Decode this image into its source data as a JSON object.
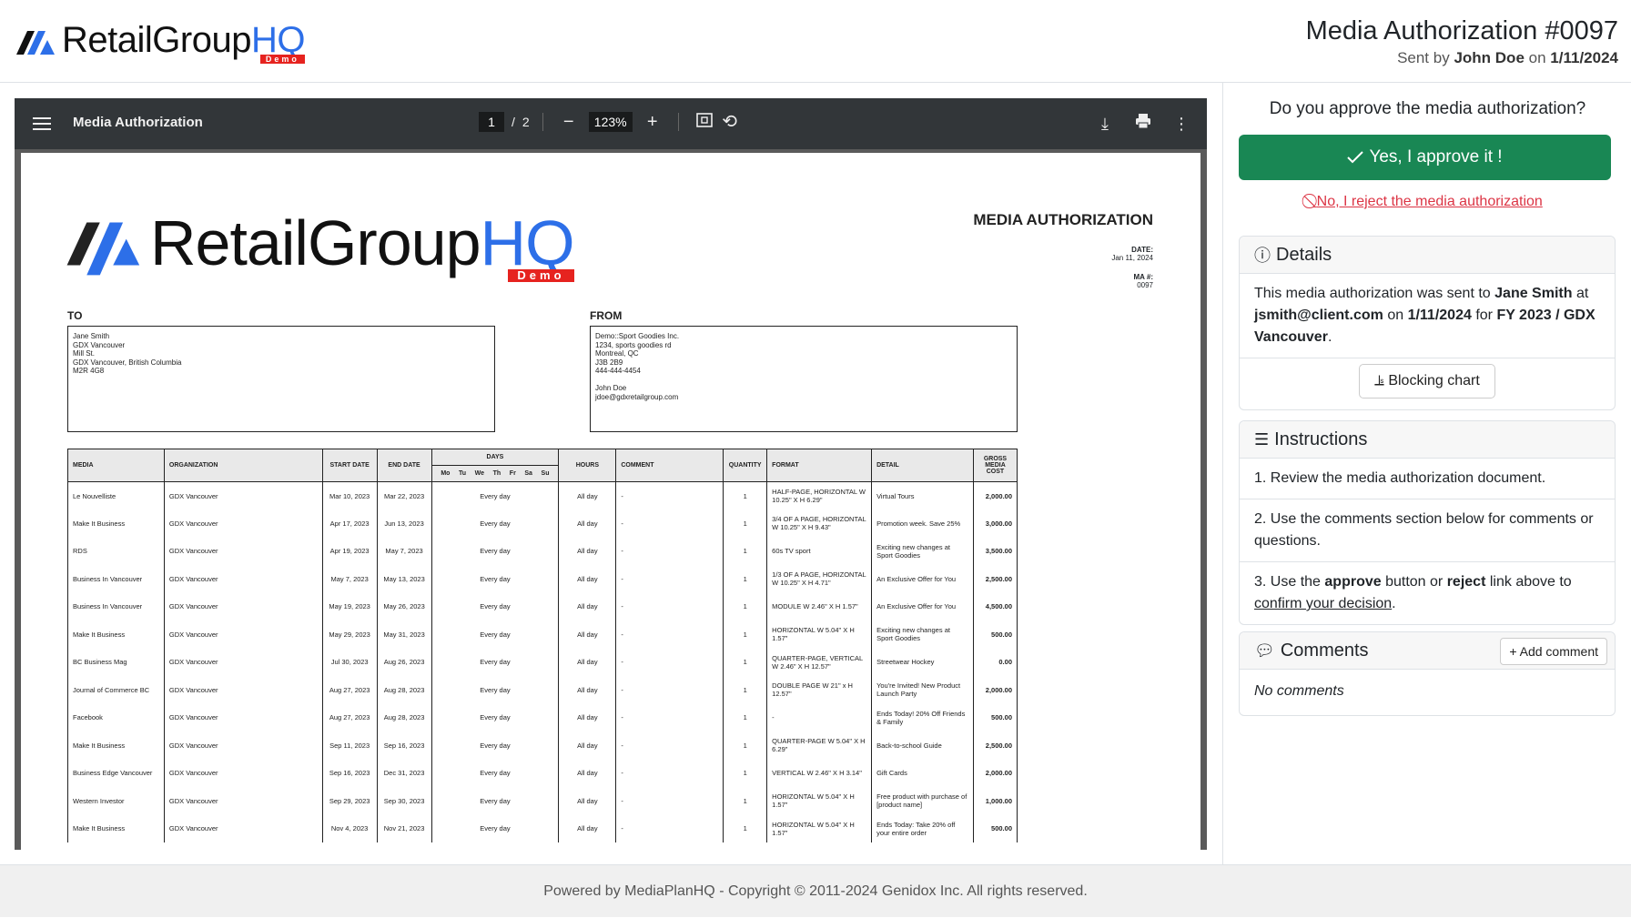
{
  "header": {
    "brand_main": "RetailGroup",
    "brand_accent": "HQ",
    "brand_tag": "Demo",
    "title": "Media Authorization #0097",
    "sent_by_prefix": "Sent by",
    "sender": "John Doe",
    "sent_on": "on",
    "date": "1/11/2024"
  },
  "viewer": {
    "title": "Media Authorization",
    "page_current": "1",
    "page_sep": "/",
    "page_total": "2",
    "zoom": "123%"
  },
  "doc": {
    "heading": "MEDIA AUTHORIZATION",
    "date_label": "DATE:",
    "date_value": "Jan 11, 2024",
    "ma_label": "MA #:",
    "ma_value": "0097",
    "to_label": "TO",
    "from_label": "FROM",
    "to_address": "Jane Smith\nGDX Vancouver\nMill St.\nGDX Vancouver, British Columbia\nM2R 4G8",
    "from_address": "Demo::Sport Goodies Inc.\n1234, sports goodies rd\nMontreal, QC\nJ3B 2B9\n444-444-4454\n\nJohn Doe\njdoe@gdxretailgroup.com",
    "columns": {
      "media": "MEDIA",
      "organization": "ORGANIZATION",
      "start": "START DATE",
      "end": "END DATE",
      "days": "DAYS",
      "hours": "HOURS",
      "comment": "COMMENT",
      "quantity": "QUANTITY",
      "format": "FORMAT",
      "detail": "DETAIL",
      "gross": "GROSS MEDIA COST"
    },
    "day_abbr": [
      "Mo",
      "Tu",
      "We",
      "Th",
      "Fr",
      "Sa",
      "Su"
    ],
    "rows": [
      {
        "media": "Le Nouvelliste",
        "org": "GDX Vancouver",
        "start": "Mar 10, 2023",
        "end": "Mar 22, 2023",
        "days": "Every day",
        "hours": "All day",
        "comment": "-",
        "qty": "1",
        "format": "HALF-PAGE, HORIZONTAL W 10.25\" X H 6.29\"",
        "detail": "Virtual Tours",
        "cost": "2,000.00"
      },
      {
        "media": "Make It Business",
        "org": "GDX Vancouver",
        "start": "Apr 17, 2023",
        "end": "Jun 13, 2023",
        "days": "Every day",
        "hours": "All day",
        "comment": "-",
        "qty": "1",
        "format": "3/4 OF A PAGE, HORIZONTAL W 10.25\" X H 9.43\"",
        "detail": "Promotion week. Save 25%",
        "cost": "3,000.00"
      },
      {
        "media": "RDS",
        "org": "GDX Vancouver",
        "start": "Apr 19, 2023",
        "end": "May 7, 2023",
        "days": "Every day",
        "hours": "All day",
        "comment": "-",
        "qty": "1",
        "format": "60s TV sport",
        "detail": "Exciting new changes at Sport Goodies",
        "cost": "3,500.00"
      },
      {
        "media": "Business In Vancouver",
        "org": "GDX Vancouver",
        "start": "May 7, 2023",
        "end": "May 13, 2023",
        "days": "Every day",
        "hours": "All day",
        "comment": "-",
        "qty": "1",
        "format": "1/3 OF A PAGE, HORIZONTAL W 10.25\" X H 4.71\"",
        "detail": "An Exclusive Offer for You",
        "cost": "2,500.00"
      },
      {
        "media": "Business In Vancouver",
        "org": "GDX Vancouver",
        "start": "May 19, 2023",
        "end": "May 26, 2023",
        "days": "Every day",
        "hours": "All day",
        "comment": "-",
        "qty": "1",
        "format": "MODULE W 2.46\" X H 1.57\"",
        "detail": "An Exclusive Offer for You",
        "cost": "4,500.00"
      },
      {
        "media": "Make It Business",
        "org": "GDX Vancouver",
        "start": "May 29, 2023",
        "end": "May 31, 2023",
        "days": "Every day",
        "hours": "All day",
        "comment": "-",
        "qty": "1",
        "format": "HORIZONTAL W 5.04\" X H 1.57\"",
        "detail": "Exciting new changes at Sport Goodies",
        "cost": "500.00"
      },
      {
        "media": "BC Business Mag",
        "org": "GDX Vancouver",
        "start": "Jul 30, 2023",
        "end": "Aug 26, 2023",
        "days": "Every day",
        "hours": "All day",
        "comment": "-",
        "qty": "1",
        "format": "QUARTER-PAGE, VERTICAL W 2.46\" X H 12.57\"",
        "detail": "Streetwear Hockey",
        "cost": "0.00"
      },
      {
        "media": "Journal of Commerce BC",
        "org": "GDX Vancouver",
        "start": "Aug 27, 2023",
        "end": "Aug 28, 2023",
        "days": "Every day",
        "hours": "All day",
        "comment": "-",
        "qty": "1",
        "format": "DOUBLE PAGE W 21\" x H 12.57\"",
        "detail": "You're Invited! New Product Launch Party",
        "cost": "2,000.00"
      },
      {
        "media": "Facebook",
        "org": "GDX Vancouver",
        "start": "Aug 27, 2023",
        "end": "Aug 28, 2023",
        "days": "Every day",
        "hours": "All day",
        "comment": "-",
        "qty": "1",
        "format": "-",
        "detail": "Ends Today! 20% Off Friends & Family",
        "cost": "500.00"
      },
      {
        "media": "Make It Business",
        "org": "GDX Vancouver",
        "start": "Sep 11, 2023",
        "end": "Sep 16, 2023",
        "days": "Every day",
        "hours": "All day",
        "comment": "-",
        "qty": "1",
        "format": "QUARTER-PAGE W 5.04\" X H 6.29\"",
        "detail": "Back-to-school Guide",
        "cost": "2,500.00"
      },
      {
        "media": "Business Edge Vancouver",
        "org": "GDX Vancouver",
        "start": "Sep 16, 2023",
        "end": "Dec 31, 2023",
        "days": "Every day",
        "hours": "All day",
        "comment": "-",
        "qty": "1",
        "format": "VERTICAL W 2.46\" X H 3.14\"",
        "detail": "Gift Cards",
        "cost": "2,000.00"
      },
      {
        "media": "Western Investor",
        "org": "GDX Vancouver",
        "start": "Sep 29, 2023",
        "end": "Sep 30, 2023",
        "days": "Every day",
        "hours": "All day",
        "comment": "-",
        "qty": "1",
        "format": "HORIZONTAL W 5.04\" X H 1.57\"",
        "detail": "Free product with purchase of [product name]",
        "cost": "1,000.00"
      },
      {
        "media": "Make It Business",
        "org": "GDX Vancouver",
        "start": "Nov 4, 2023",
        "end": "Nov 21, 2023",
        "days": "Every day",
        "hours": "All day",
        "comment": "-",
        "qty": "1",
        "format": "HORIZONTAL W 5.04\" X H 1.57\"",
        "detail": "Ends Today: Take 20% off your entire order",
        "cost": "500.00"
      }
    ]
  },
  "sidebar": {
    "question": "Do you approve the media authorization?",
    "approve_label": "Yes, I approve it !",
    "reject_label": "No, I reject the media authorization",
    "details": {
      "title": "Details",
      "t1": "This media authorization was sent to",
      "recipient": "Jane Smith",
      "t2": "at",
      "email": "jsmith@client.com",
      "t3": "on",
      "date": "1/11/2024",
      "t4": "for",
      "plan": "FY 2023 / GDX Vancouver",
      "t5": ".",
      "chart_button": "Blocking chart"
    },
    "instructions": {
      "title": "Instructions",
      "i1": "1. Review the media authorization document.",
      "i2": "2. Use the comments section below for comments or questions.",
      "i3_a": "3. Use the",
      "i3_approve": "approve",
      "i3_b": "button or",
      "i3_reject": "reject",
      "i3_c": "link above to",
      "i3_link": "confirm your decision",
      "i3_d": "."
    },
    "comments": {
      "title": "Comments",
      "add_label": "Add comment",
      "empty": "No comments"
    }
  },
  "footer": {
    "text": "Powered by MediaPlanHQ - Copyright © 2011-2024 Genidox Inc. All rights reserved."
  },
  "colors": {
    "approve": "#198754",
    "reject": "#dc3545",
    "brand_accent": "#2d6fe8",
    "demo_tag": "#e6231f"
  }
}
